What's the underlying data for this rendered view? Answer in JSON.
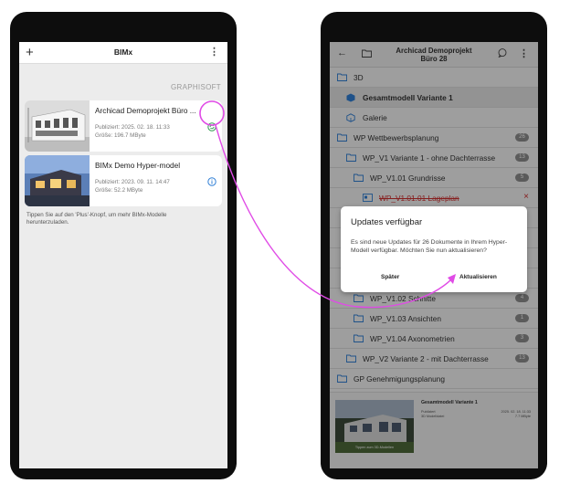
{
  "left": {
    "app_title": "BIMx",
    "brand": "GRAPHISOFT",
    "models": [
      {
        "title": "Archicad Demoprojekt Büro ...",
        "published": "Publiziert: 2025. 02. 18. 11:33",
        "size": "Größe: 196.7 MByte",
        "status_icon": "update-available-icon"
      },
      {
        "title": "BIMx Demo Hyper-model",
        "published": "Publiziert: 2023. 09. 11. 14:47",
        "size": "Größe: 52.2 MByte",
        "status_icon": "info-icon"
      }
    ],
    "tip": "Tippen Sie auf den 'Plus'-Knopf, um mehr BIMx-Modelle herunterzuladen."
  },
  "right": {
    "title_line1": "Archicad Demoprojekt",
    "title_line2": "Büro 28",
    "tree": [
      {
        "label": "3D",
        "badge": ""
      },
      {
        "label": "Gesamtmodell Variante 1",
        "badge": ""
      },
      {
        "label": "Galerie",
        "badge": ""
      },
      {
        "label": "WP Wettbewerbsplanung",
        "badge": "26"
      },
      {
        "label": "WP_V1 Variante 1 - ohne Dachterrasse",
        "badge": "13"
      },
      {
        "label": "WP_V1.01 Grundrisse",
        "badge": "5"
      },
      {
        "label": "WP_V1.01.01 Lageplan",
        "badge": ""
      },
      {
        "label": "WP_V1.02 Schnitte",
        "badge": "4"
      },
      {
        "label": "WP_V1.03 Ansichten",
        "badge": "1"
      },
      {
        "label": "WP_V1.04 Axonometrien",
        "badge": "3"
      },
      {
        "label": "WP_V2 Variante 2 - mit Dachterrasse",
        "badge": "13"
      },
      {
        "label": "GP Genehmigungsplanung",
        "badge": ""
      }
    ],
    "preview": {
      "title": "Gesamtmodell Variante 1",
      "meta1": "Publiziert",
      "meta2": "3D Modelldatei",
      "date": "2025. 02. 18. 11:33",
      "size": "7.7 MByte",
      "caption": "Tippen zum 3D-Modellen"
    },
    "dialog": {
      "title": "Updates verfügbar",
      "body": "Es sind neue Updates für 26 Dokumente in Ihrem Hyper-Modell verfügbar. Möchten Sie nun aktualisieren?",
      "later": "Später",
      "update": "Aktualisieren"
    }
  },
  "colors": {
    "accent_blue": "#2f7fd6",
    "update_green": "#2e9a4e",
    "annotation_magenta": "#e04be6",
    "delete_red": "#d23030"
  }
}
